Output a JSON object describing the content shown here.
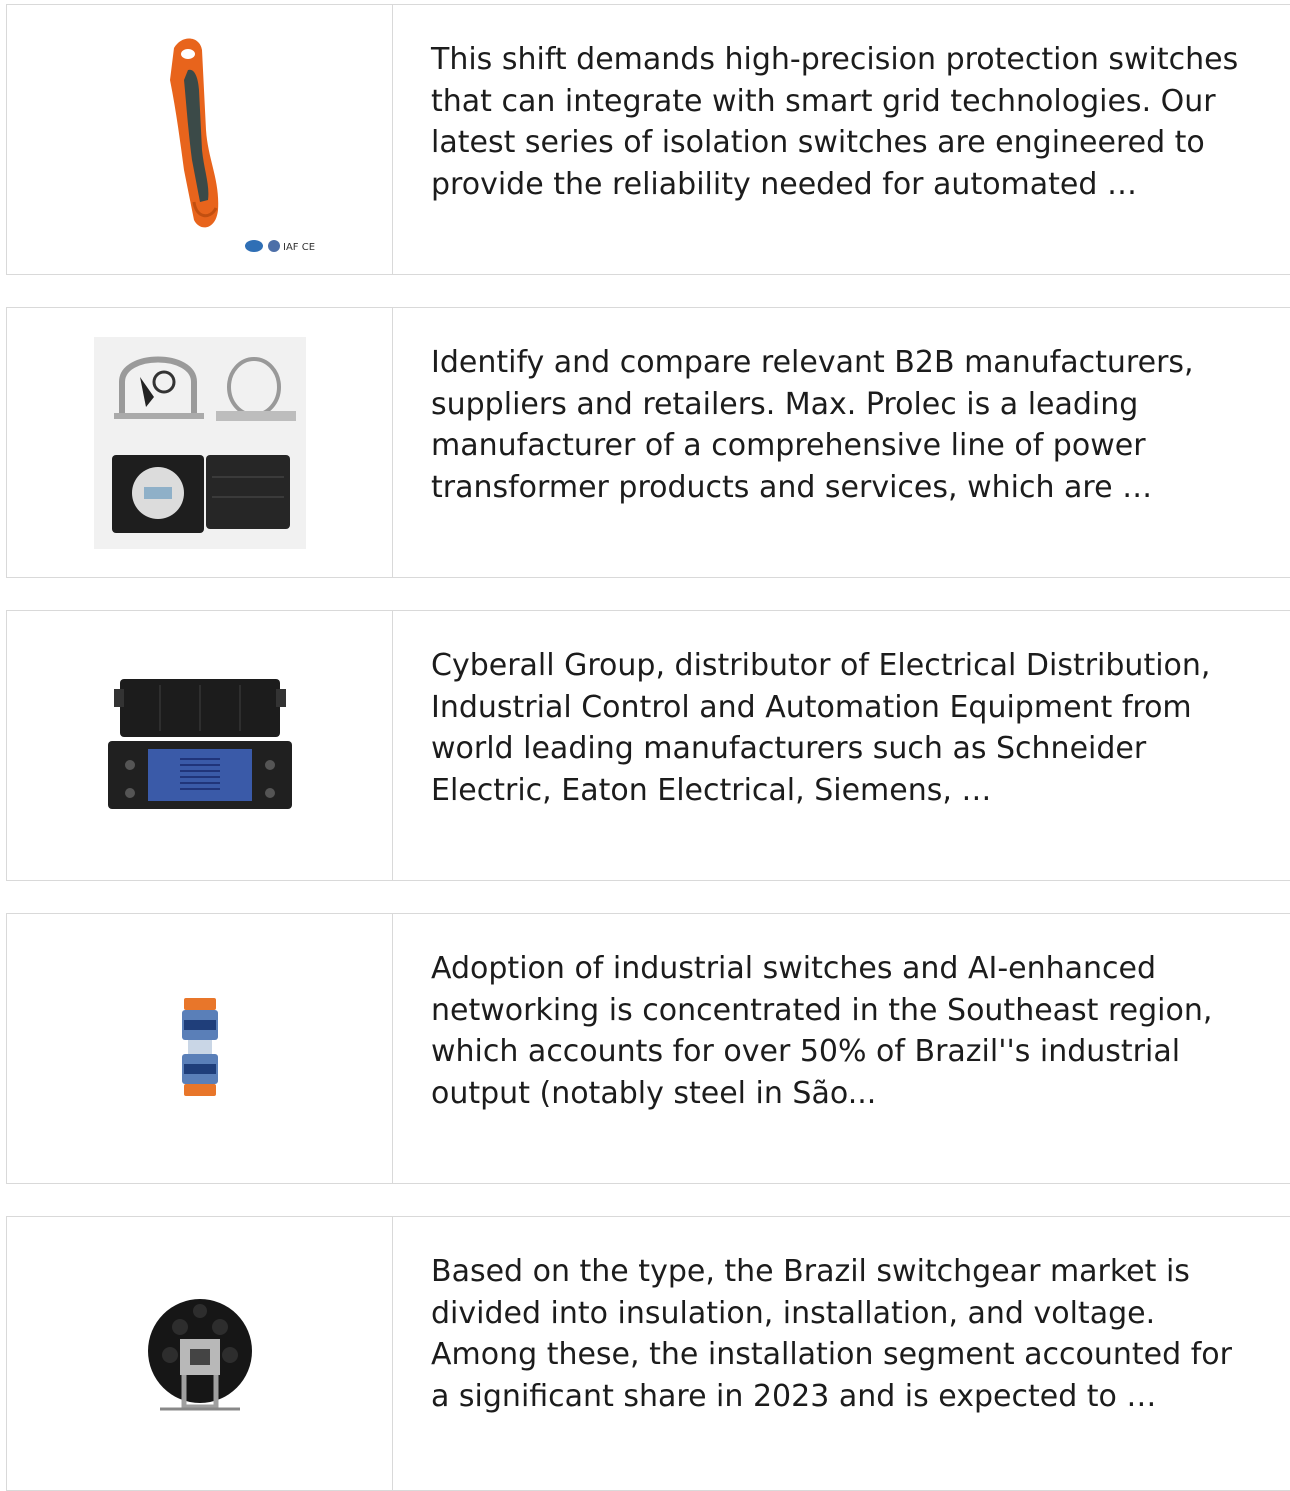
{
  "items": [
    {
      "image": "orange-handheld-tool-image",
      "image_marks": "IAF CE",
      "text": "This shift demands high-precision protection switches that can integrate with smart grid technologies. Our latest series of isolation switches are engineered to provide the reliability needed for automated …"
    },
    {
      "image": "splice-closure-kit-image",
      "text": "Identify and compare relevant B2B manufacturers, suppliers and retailers. Max. Prolec is a leading manufacturer of a comprehensive line of power transformer products and services, which are …"
    },
    {
      "image": "black-enclosure-box-image",
      "text": "Cyberall Group, distributor of Electrical Distribution, Industrial Control and Automation Equipment from world leading manufacturers such as Schneider Electric, Eaton Electrical, Siemens, …"
    },
    {
      "image": "duct-connector-image",
      "text": "Adoption of industrial switches and AI-enhanced networking is concentrated in the Southeast region, which accounts for over 50% of Brazil''s industrial output (notably steel in São..."
    },
    {
      "image": "round-terminal-box-image",
      "text": "Based on the type, the Brazil switchgear market is divided into insulation, installation, and voltage. Among these, the installation segment accounted for a significant share in 2023 and is expected to …"
    }
  ]
}
